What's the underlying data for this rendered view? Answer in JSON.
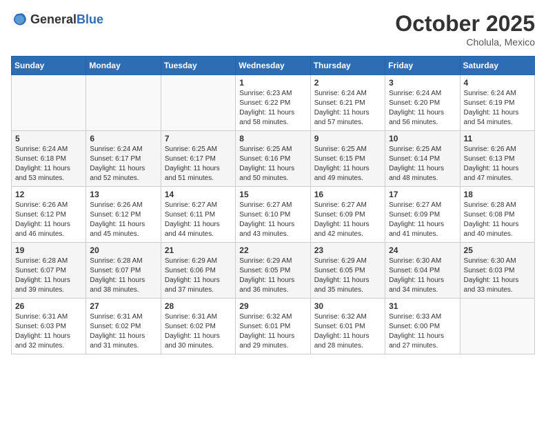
{
  "logo": {
    "general": "General",
    "blue": "Blue"
  },
  "header": {
    "month": "October 2025",
    "location": "Cholula, Mexico"
  },
  "weekdays": [
    "Sunday",
    "Monday",
    "Tuesday",
    "Wednesday",
    "Thursday",
    "Friday",
    "Saturday"
  ],
  "weeks": [
    [
      {
        "day": "",
        "sunrise": "",
        "sunset": "",
        "daylight": ""
      },
      {
        "day": "",
        "sunrise": "",
        "sunset": "",
        "daylight": ""
      },
      {
        "day": "",
        "sunrise": "",
        "sunset": "",
        "daylight": ""
      },
      {
        "day": "1",
        "sunrise": "Sunrise: 6:23 AM",
        "sunset": "Sunset: 6:22 PM",
        "daylight": "Daylight: 11 hours and 58 minutes."
      },
      {
        "day": "2",
        "sunrise": "Sunrise: 6:24 AM",
        "sunset": "Sunset: 6:21 PM",
        "daylight": "Daylight: 11 hours and 57 minutes."
      },
      {
        "day": "3",
        "sunrise": "Sunrise: 6:24 AM",
        "sunset": "Sunset: 6:20 PM",
        "daylight": "Daylight: 11 hours and 56 minutes."
      },
      {
        "day": "4",
        "sunrise": "Sunrise: 6:24 AM",
        "sunset": "Sunset: 6:19 PM",
        "daylight": "Daylight: 11 hours and 54 minutes."
      }
    ],
    [
      {
        "day": "5",
        "sunrise": "Sunrise: 6:24 AM",
        "sunset": "Sunset: 6:18 PM",
        "daylight": "Daylight: 11 hours and 53 minutes."
      },
      {
        "day": "6",
        "sunrise": "Sunrise: 6:24 AM",
        "sunset": "Sunset: 6:17 PM",
        "daylight": "Daylight: 11 hours and 52 minutes."
      },
      {
        "day": "7",
        "sunrise": "Sunrise: 6:25 AM",
        "sunset": "Sunset: 6:17 PM",
        "daylight": "Daylight: 11 hours and 51 minutes."
      },
      {
        "day": "8",
        "sunrise": "Sunrise: 6:25 AM",
        "sunset": "Sunset: 6:16 PM",
        "daylight": "Daylight: 11 hours and 50 minutes."
      },
      {
        "day": "9",
        "sunrise": "Sunrise: 6:25 AM",
        "sunset": "Sunset: 6:15 PM",
        "daylight": "Daylight: 11 hours and 49 minutes."
      },
      {
        "day": "10",
        "sunrise": "Sunrise: 6:25 AM",
        "sunset": "Sunset: 6:14 PM",
        "daylight": "Daylight: 11 hours and 48 minutes."
      },
      {
        "day": "11",
        "sunrise": "Sunrise: 6:26 AM",
        "sunset": "Sunset: 6:13 PM",
        "daylight": "Daylight: 11 hours and 47 minutes."
      }
    ],
    [
      {
        "day": "12",
        "sunrise": "Sunrise: 6:26 AM",
        "sunset": "Sunset: 6:12 PM",
        "daylight": "Daylight: 11 hours and 46 minutes."
      },
      {
        "day": "13",
        "sunrise": "Sunrise: 6:26 AM",
        "sunset": "Sunset: 6:12 PM",
        "daylight": "Daylight: 11 hours and 45 minutes."
      },
      {
        "day": "14",
        "sunrise": "Sunrise: 6:27 AM",
        "sunset": "Sunset: 6:11 PM",
        "daylight": "Daylight: 11 hours and 44 minutes."
      },
      {
        "day": "15",
        "sunrise": "Sunrise: 6:27 AM",
        "sunset": "Sunset: 6:10 PM",
        "daylight": "Daylight: 11 hours and 43 minutes."
      },
      {
        "day": "16",
        "sunrise": "Sunrise: 6:27 AM",
        "sunset": "Sunset: 6:09 PM",
        "daylight": "Daylight: 11 hours and 42 minutes."
      },
      {
        "day": "17",
        "sunrise": "Sunrise: 6:27 AM",
        "sunset": "Sunset: 6:09 PM",
        "daylight": "Daylight: 11 hours and 41 minutes."
      },
      {
        "day": "18",
        "sunrise": "Sunrise: 6:28 AM",
        "sunset": "Sunset: 6:08 PM",
        "daylight": "Daylight: 11 hours and 40 minutes."
      }
    ],
    [
      {
        "day": "19",
        "sunrise": "Sunrise: 6:28 AM",
        "sunset": "Sunset: 6:07 PM",
        "daylight": "Daylight: 11 hours and 39 minutes."
      },
      {
        "day": "20",
        "sunrise": "Sunrise: 6:28 AM",
        "sunset": "Sunset: 6:07 PM",
        "daylight": "Daylight: 11 hours and 38 minutes."
      },
      {
        "day": "21",
        "sunrise": "Sunrise: 6:29 AM",
        "sunset": "Sunset: 6:06 PM",
        "daylight": "Daylight: 11 hours and 37 minutes."
      },
      {
        "day": "22",
        "sunrise": "Sunrise: 6:29 AM",
        "sunset": "Sunset: 6:05 PM",
        "daylight": "Daylight: 11 hours and 36 minutes."
      },
      {
        "day": "23",
        "sunrise": "Sunrise: 6:29 AM",
        "sunset": "Sunset: 6:05 PM",
        "daylight": "Daylight: 11 hours and 35 minutes."
      },
      {
        "day": "24",
        "sunrise": "Sunrise: 6:30 AM",
        "sunset": "Sunset: 6:04 PM",
        "daylight": "Daylight: 11 hours and 34 minutes."
      },
      {
        "day": "25",
        "sunrise": "Sunrise: 6:30 AM",
        "sunset": "Sunset: 6:03 PM",
        "daylight": "Daylight: 11 hours and 33 minutes."
      }
    ],
    [
      {
        "day": "26",
        "sunrise": "Sunrise: 6:31 AM",
        "sunset": "Sunset: 6:03 PM",
        "daylight": "Daylight: 11 hours and 32 minutes."
      },
      {
        "day": "27",
        "sunrise": "Sunrise: 6:31 AM",
        "sunset": "Sunset: 6:02 PM",
        "daylight": "Daylight: 11 hours and 31 minutes."
      },
      {
        "day": "28",
        "sunrise": "Sunrise: 6:31 AM",
        "sunset": "Sunset: 6:02 PM",
        "daylight": "Daylight: 11 hours and 30 minutes."
      },
      {
        "day": "29",
        "sunrise": "Sunrise: 6:32 AM",
        "sunset": "Sunset: 6:01 PM",
        "daylight": "Daylight: 11 hours and 29 minutes."
      },
      {
        "day": "30",
        "sunrise": "Sunrise: 6:32 AM",
        "sunset": "Sunset: 6:01 PM",
        "daylight": "Daylight: 11 hours and 28 minutes."
      },
      {
        "day": "31",
        "sunrise": "Sunrise: 6:33 AM",
        "sunset": "Sunset: 6:00 PM",
        "daylight": "Daylight: 11 hours and 27 minutes."
      },
      {
        "day": "",
        "sunrise": "",
        "sunset": "",
        "daylight": ""
      }
    ]
  ]
}
